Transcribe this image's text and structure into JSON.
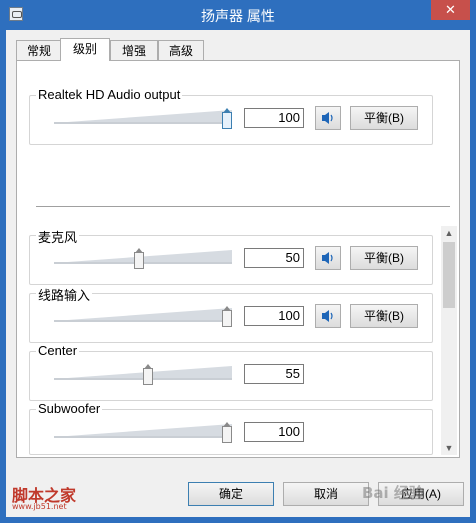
{
  "window": {
    "title": "扬声器 属性",
    "close_label": "✕"
  },
  "tabs": [
    {
      "label": "常规",
      "active": false
    },
    {
      "label": "级别",
      "active": true
    },
    {
      "label": "增强",
      "active": false
    },
    {
      "label": "高级",
      "active": false
    }
  ],
  "main_device": {
    "label": "Realtek HD Audio output",
    "level": 100,
    "value_text": "100",
    "balance_label": "平衡(B)"
  },
  "channels": [
    {
      "label": "麦克风",
      "level": 50,
      "value_text": "50",
      "balance_label": "平衡(B)",
      "has_mute": true
    },
    {
      "label": "线路输入",
      "level": 100,
      "value_text": "100",
      "balance_label": "平衡(B)",
      "has_mute": true
    },
    {
      "label": "Center",
      "level": 55,
      "value_text": "55",
      "has_mute": false
    },
    {
      "label": "Subwoofer",
      "level": 100,
      "value_text": "100",
      "has_mute": false
    }
  ],
  "footer": {
    "ok_label": "确定",
    "cancel_label": "取消",
    "apply_label": "应用(A)"
  },
  "watermark": {
    "site_name": "脚本之家",
    "site_url": "www.jb51.net",
    "baidu_text": "Bai 经验"
  },
  "colors": {
    "titlebar": "#2e6fbe",
    "close": "#c7504b",
    "accent": "#1e66b8"
  }
}
